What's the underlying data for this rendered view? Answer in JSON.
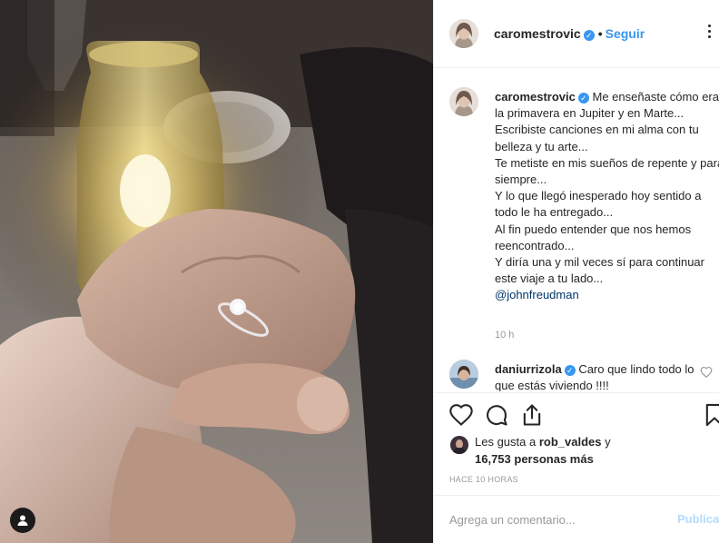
{
  "post": {
    "author": "caromestrovic",
    "follow_label": "Seguir",
    "dot": "•",
    "verified_mark": "✓"
  },
  "caption": {
    "username": "caromestrovic",
    "lines": [
      "Me enseñaste cómo era la primavera en Jupiter y en Marte...",
      "Escribiste canciones en mi alma con tu belleza y tu arte...",
      "Te metiste en mis sueños de repente y para siempre...",
      "Y lo que llegó inesperado hoy sentido a todo le ha entregado...",
      "Al fin puedo entender que nos hemos reencontrado...",
      "Y diría una y mil veces sí para continuar este viaje a tu lado..."
    ],
    "mention": "@johnfreudman",
    "time": "10 h"
  },
  "comment": {
    "username": "daniurrizola",
    "text": "Caro que lindo todo lo que estás viviendo !!!!"
  },
  "likes": {
    "prefix": "Les gusta a",
    "user": "rob_valdes",
    "conj": "y",
    "count": "16,753 personas más"
  },
  "timestamp": "HACE 10 HORAS",
  "add_comment": {
    "placeholder": "Agrega un comentario...",
    "publish_label": "Publicar"
  },
  "icons": {
    "like": "heart-icon",
    "comment": "comment-icon",
    "share": "share-icon",
    "save": "bookmark-icon",
    "more": "more-options-icon",
    "user_tag": "user-tag-icon"
  },
  "colors": {
    "accent": "#3897f0",
    "publish_disabled": "#b3dbff",
    "border": "#efefef",
    "muted": "#999999"
  }
}
